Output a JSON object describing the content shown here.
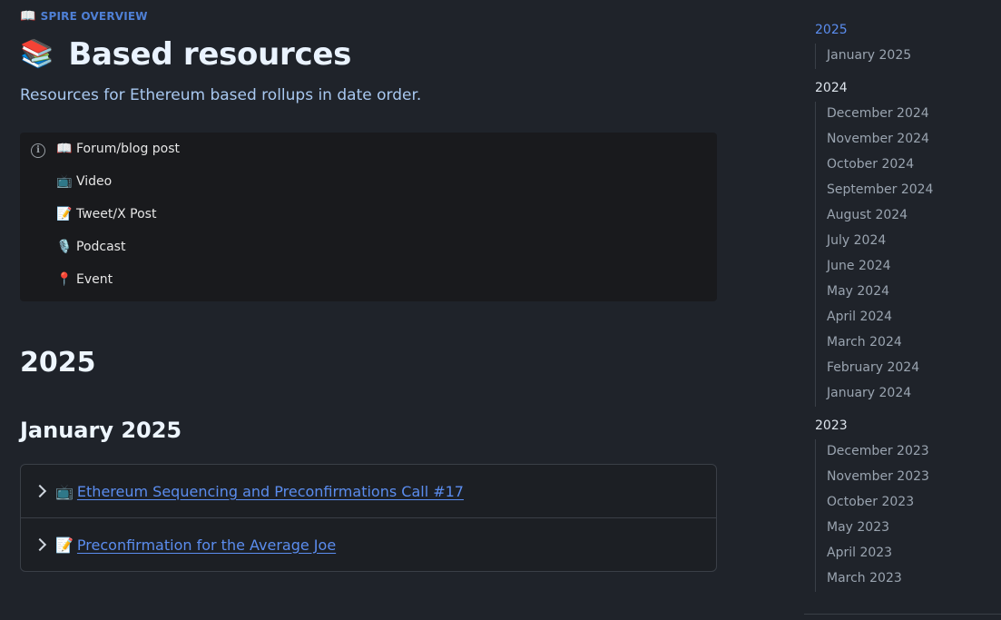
{
  "breadcrumb": {
    "icon": "📖",
    "label": "SPIRE OVERVIEW"
  },
  "page": {
    "icon": "📚",
    "title": "Based resources",
    "subtitle": "Resources for Ethereum based rollups in date order."
  },
  "legend": {
    "info_icon": "info-icon",
    "items": [
      {
        "icon": "📖",
        "label": "Forum/blog post"
      },
      {
        "icon": "📺",
        "label": "Video"
      },
      {
        "icon": "📝",
        "label": "Tweet/X Post"
      },
      {
        "icon": "🎙️",
        "label": "Podcast"
      },
      {
        "icon": "📍",
        "label": "Event"
      }
    ]
  },
  "content": {
    "year_heading": "2025",
    "month_heading": "January 2025",
    "resources": [
      {
        "icon": "📺",
        "title": "Ethereum Sequencing and Preconfirmations Call #17"
      },
      {
        "icon": "📝",
        "title": "Preconfirmation for the Average Joe"
      }
    ]
  },
  "toc": {
    "groups": [
      {
        "year": "2025",
        "months": [
          "January 2025"
        ]
      },
      {
        "year": "2024",
        "months": [
          "December 2024",
          "November 2024",
          "October 2024",
          "September 2024",
          "August 2024",
          "July 2024",
          "June 2024",
          "May 2024",
          "April 2024",
          "March 2024",
          "February 2024",
          "January 2024"
        ]
      },
      {
        "year": "2023",
        "months": [
          "December 2023",
          "November 2023",
          "October 2023",
          "May 2023",
          "April 2023",
          "March 2023"
        ]
      }
    ]
  },
  "colors": {
    "background": "#1f232a",
    "link": "#5b8def",
    "accent": "#4f80d6"
  }
}
